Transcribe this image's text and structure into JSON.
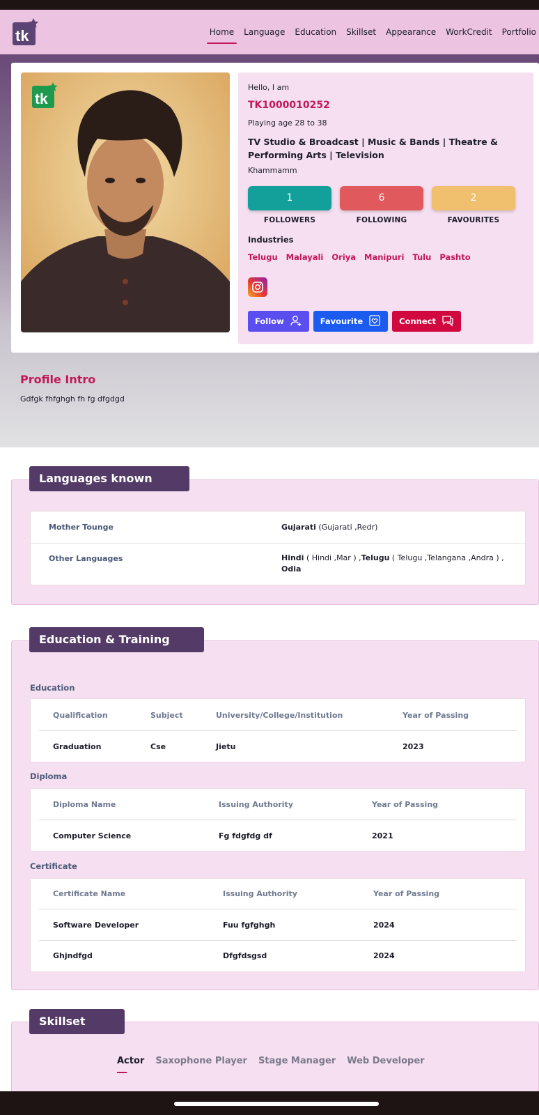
{
  "nav": {
    "logo_text": "tk",
    "links": [
      "Home",
      "Language",
      "Education",
      "Skillset",
      "Appearance",
      "WorkCredit",
      "Portfolio"
    ],
    "active": "Home"
  },
  "profile": {
    "hello": "Hello, I am",
    "id": "TK1000010252",
    "playing_age": "Playing age 28 to 38",
    "categories": "TV Studio & Broadcast | Music & Bands | Theatre & Performing Arts | Television",
    "city": "Khammamm",
    "stats": [
      {
        "value": "1",
        "label": "FOLLOWERS",
        "color": "#14a09a"
      },
      {
        "value": "6",
        "label": "FOLLOWING",
        "color": "#e0595d"
      },
      {
        "value": "2",
        "label": "FAVOURITES",
        "color": "#f0c06f"
      }
    ],
    "industries_title": "Industries",
    "industries": [
      "Telugu",
      "Malayali",
      "Oriya",
      "Manipuri",
      "Tulu",
      "Pashto"
    ],
    "actions": [
      {
        "label": "Follow",
        "color": "#5b4ef0",
        "icon": "add-user-icon"
      },
      {
        "label": "Favourite",
        "color": "#1b5bf0",
        "icon": "favourite-icon"
      },
      {
        "label": "Connect",
        "color": "#d1083f",
        "icon": "chat-icon"
      }
    ]
  },
  "intro": {
    "title": "Profile Intro",
    "text": "Gdfgk fhfghgh fh fg dfgdgd"
  },
  "languages": {
    "title": "Languages known",
    "mother_label": "Mother Tounge",
    "mother_main": "Gujarati",
    "mother_detail": " (Gujarati ,Redr)",
    "other_label": "Other Languages",
    "other_1": "Hindi",
    "other_1_detail": " ( Hindi ,Mar ) ,",
    "other_2": "Telugu",
    "other_2_detail": " ( Telugu ,Telangana ,Andra ) ,",
    "other_3": "Odia"
  },
  "education": {
    "title": "Education & Training",
    "education_title": "Education",
    "education_headers": [
      "Qualification",
      "Subject",
      "University/College/Institution",
      "Year of Passing"
    ],
    "education_rows": [
      [
        "Graduation",
        "Cse",
        "Jietu",
        "2023"
      ]
    ],
    "diploma_title": "Diploma",
    "diploma_headers": [
      "Diploma Name",
      "Issuing Authority",
      "Year of Passing"
    ],
    "diploma_rows": [
      [
        "Computer Science",
        "Fg fdgfdg df",
        "2021"
      ]
    ],
    "certificate_title": "Certificate",
    "certificate_headers": [
      "Certificate Name",
      "Issuing Authority",
      "Year of Passing"
    ],
    "certificate_rows": [
      [
        "Software Developer",
        "Fuu fgfghgh",
        "2024"
      ],
      [
        "Ghjndfgd",
        "Dfgfdsgsd",
        "2024"
      ]
    ]
  },
  "skillset": {
    "title": "Skillset",
    "tabs": [
      "Actor",
      "Saxophone Player",
      "Stage Manager",
      "Web Developer"
    ],
    "active": "Actor"
  }
}
